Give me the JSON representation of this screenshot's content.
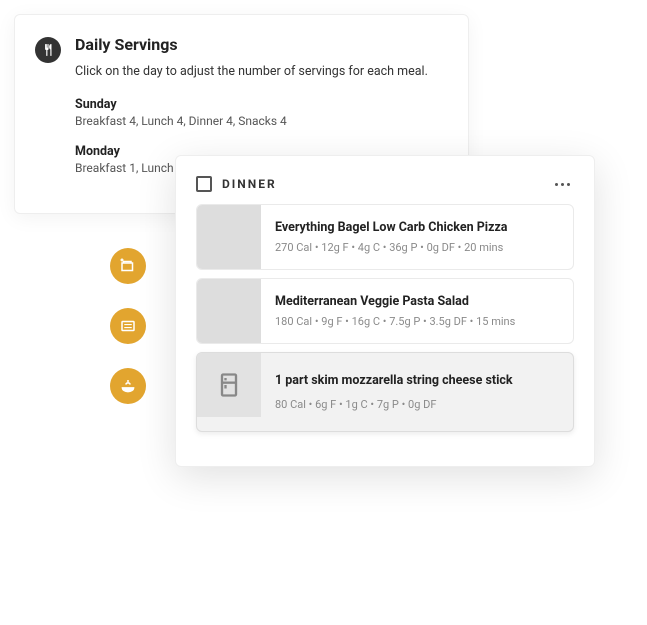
{
  "servings": {
    "title": "Daily Servings",
    "description": "Click on the day to adjust the number of servings for each meal.",
    "days": [
      {
        "name": "Sunday",
        "detail": "Breakfast 4, Lunch 4, Dinner 4, Snacks 4"
      },
      {
        "name": "Monday",
        "detail": "Breakfast 1, Lunch"
      }
    ]
  },
  "meal": {
    "label": "DINNER",
    "items": [
      {
        "name": "Everything Bagel Low Carb Chicken Pizza",
        "stats": "270 Cal • 12g F • 4g C • 36g P • 0g DF • 20 mins"
      },
      {
        "name": "Mediterranean Veggie Pasta Salad",
        "stats": "180 Cal • 9g F • 16g C • 7.5g P • 3.5g DF • 15 mins"
      },
      {
        "name": "1 part skim mozzarella string cheese stick",
        "stats": "80 Cal • 6g F • 1g C • 7g P • 0g DF"
      }
    ]
  }
}
